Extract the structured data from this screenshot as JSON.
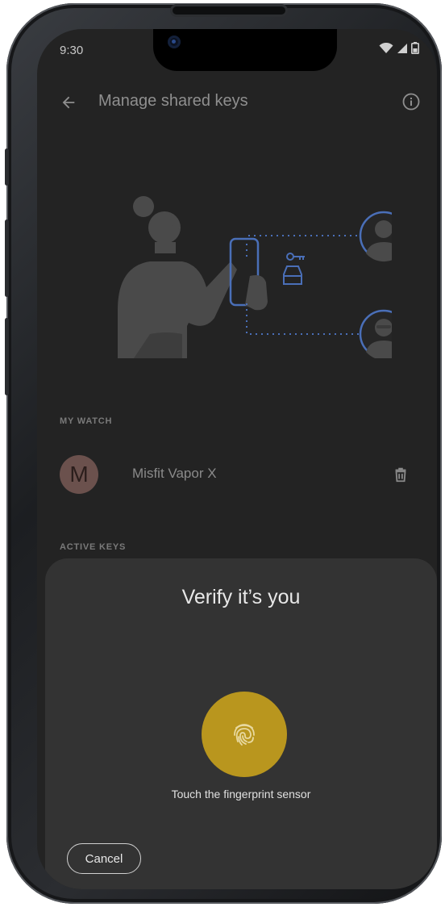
{
  "status_bar": {
    "time": "9:30",
    "icons": [
      "wifi-icon",
      "cellular-icon",
      "battery-icon"
    ]
  },
  "app_bar": {
    "title": "Manage shared keys",
    "back_icon": "arrow-back-icon",
    "info_icon": "info-icon"
  },
  "sections": {
    "my_watch_label": "MY WATCH",
    "active_keys_label": "ACTIVE KEYS"
  },
  "watch": {
    "avatar_letter": "M",
    "name": "Misfit Vapor X",
    "delete_icon": "trash-icon"
  },
  "verify_sheet": {
    "title": "Verify it’s you",
    "instruction": "Touch the fingerprint sensor",
    "cancel_label": "Cancel",
    "fingerprint_icon": "fingerprint-icon"
  },
  "colors": {
    "screen_bg": "#232323",
    "sheet_bg": "#333333",
    "fingerprint_accent": "#b9961e",
    "avatar_bg": "#6b514d",
    "illustration_accent": "#4a6fb8"
  }
}
